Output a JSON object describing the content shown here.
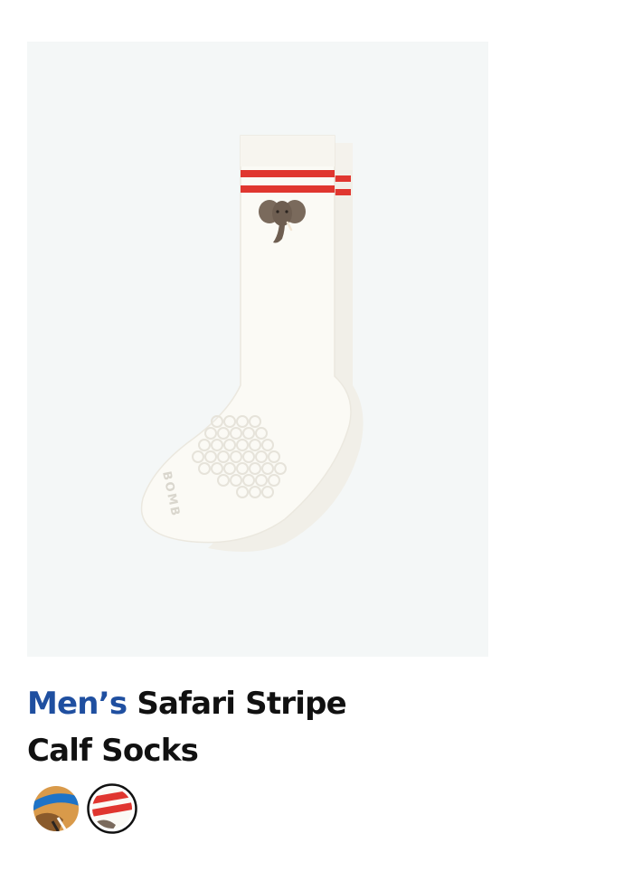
{
  "product": {
    "gender": "Men’s",
    "name": "Safari Stripe Calf Socks",
    "sole_brand_text": "BOMB"
  },
  "image": {
    "background_color": "#f4f7f7",
    "sock_color": "#fbfaf5",
    "stripe_color": "#e0362f",
    "elephant_color": "#7a6a5c"
  },
  "swatches": [
    {
      "name": "blue-brown",
      "colors": [
        "#1e73c7",
        "#d99a4a",
        "#8a5a2b"
      ],
      "selected": false
    },
    {
      "name": "red-stripe-white",
      "colors": [
        "#fbfaf5",
        "#e0362f",
        "#7a6a5c"
      ],
      "selected": true
    }
  ]
}
